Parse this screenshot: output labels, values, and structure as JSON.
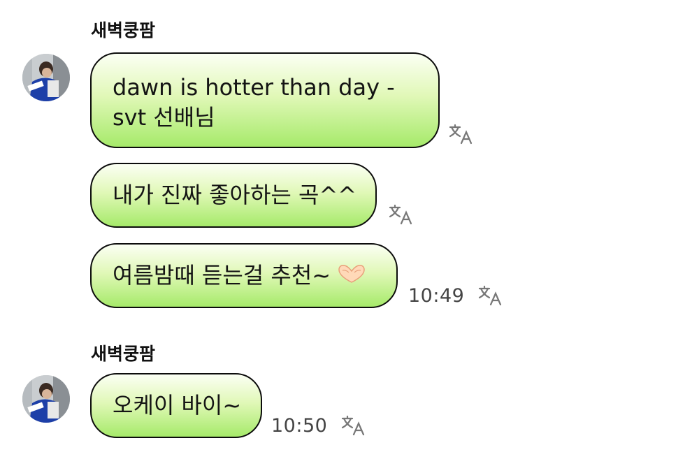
{
  "groups": [
    {
      "sender": "새벽쿵팜",
      "messages": [
        {
          "lines": [
            "dawn is hotter than day -",
            "svt 선배님"
          ]
        },
        {
          "text": "내가 진짜 좋아하는 곡^^"
        },
        {
          "text": "여름밤때 듣는걸 추천~",
          "emoji": "heart-hands-emoji",
          "time": "10:49"
        }
      ]
    },
    {
      "sender": "새벽쿵팜",
      "messages": [
        {
          "text": "오케이 바이~",
          "time": "10:50"
        }
      ]
    }
  ],
  "icons": {
    "translate": "translate-icon",
    "avatar": "avatar-photo"
  },
  "colors": {
    "bubble_top": "#fbfff4",
    "bubble_bottom": "#a6ea6a",
    "bubble_border": "#0c0c0c"
  }
}
